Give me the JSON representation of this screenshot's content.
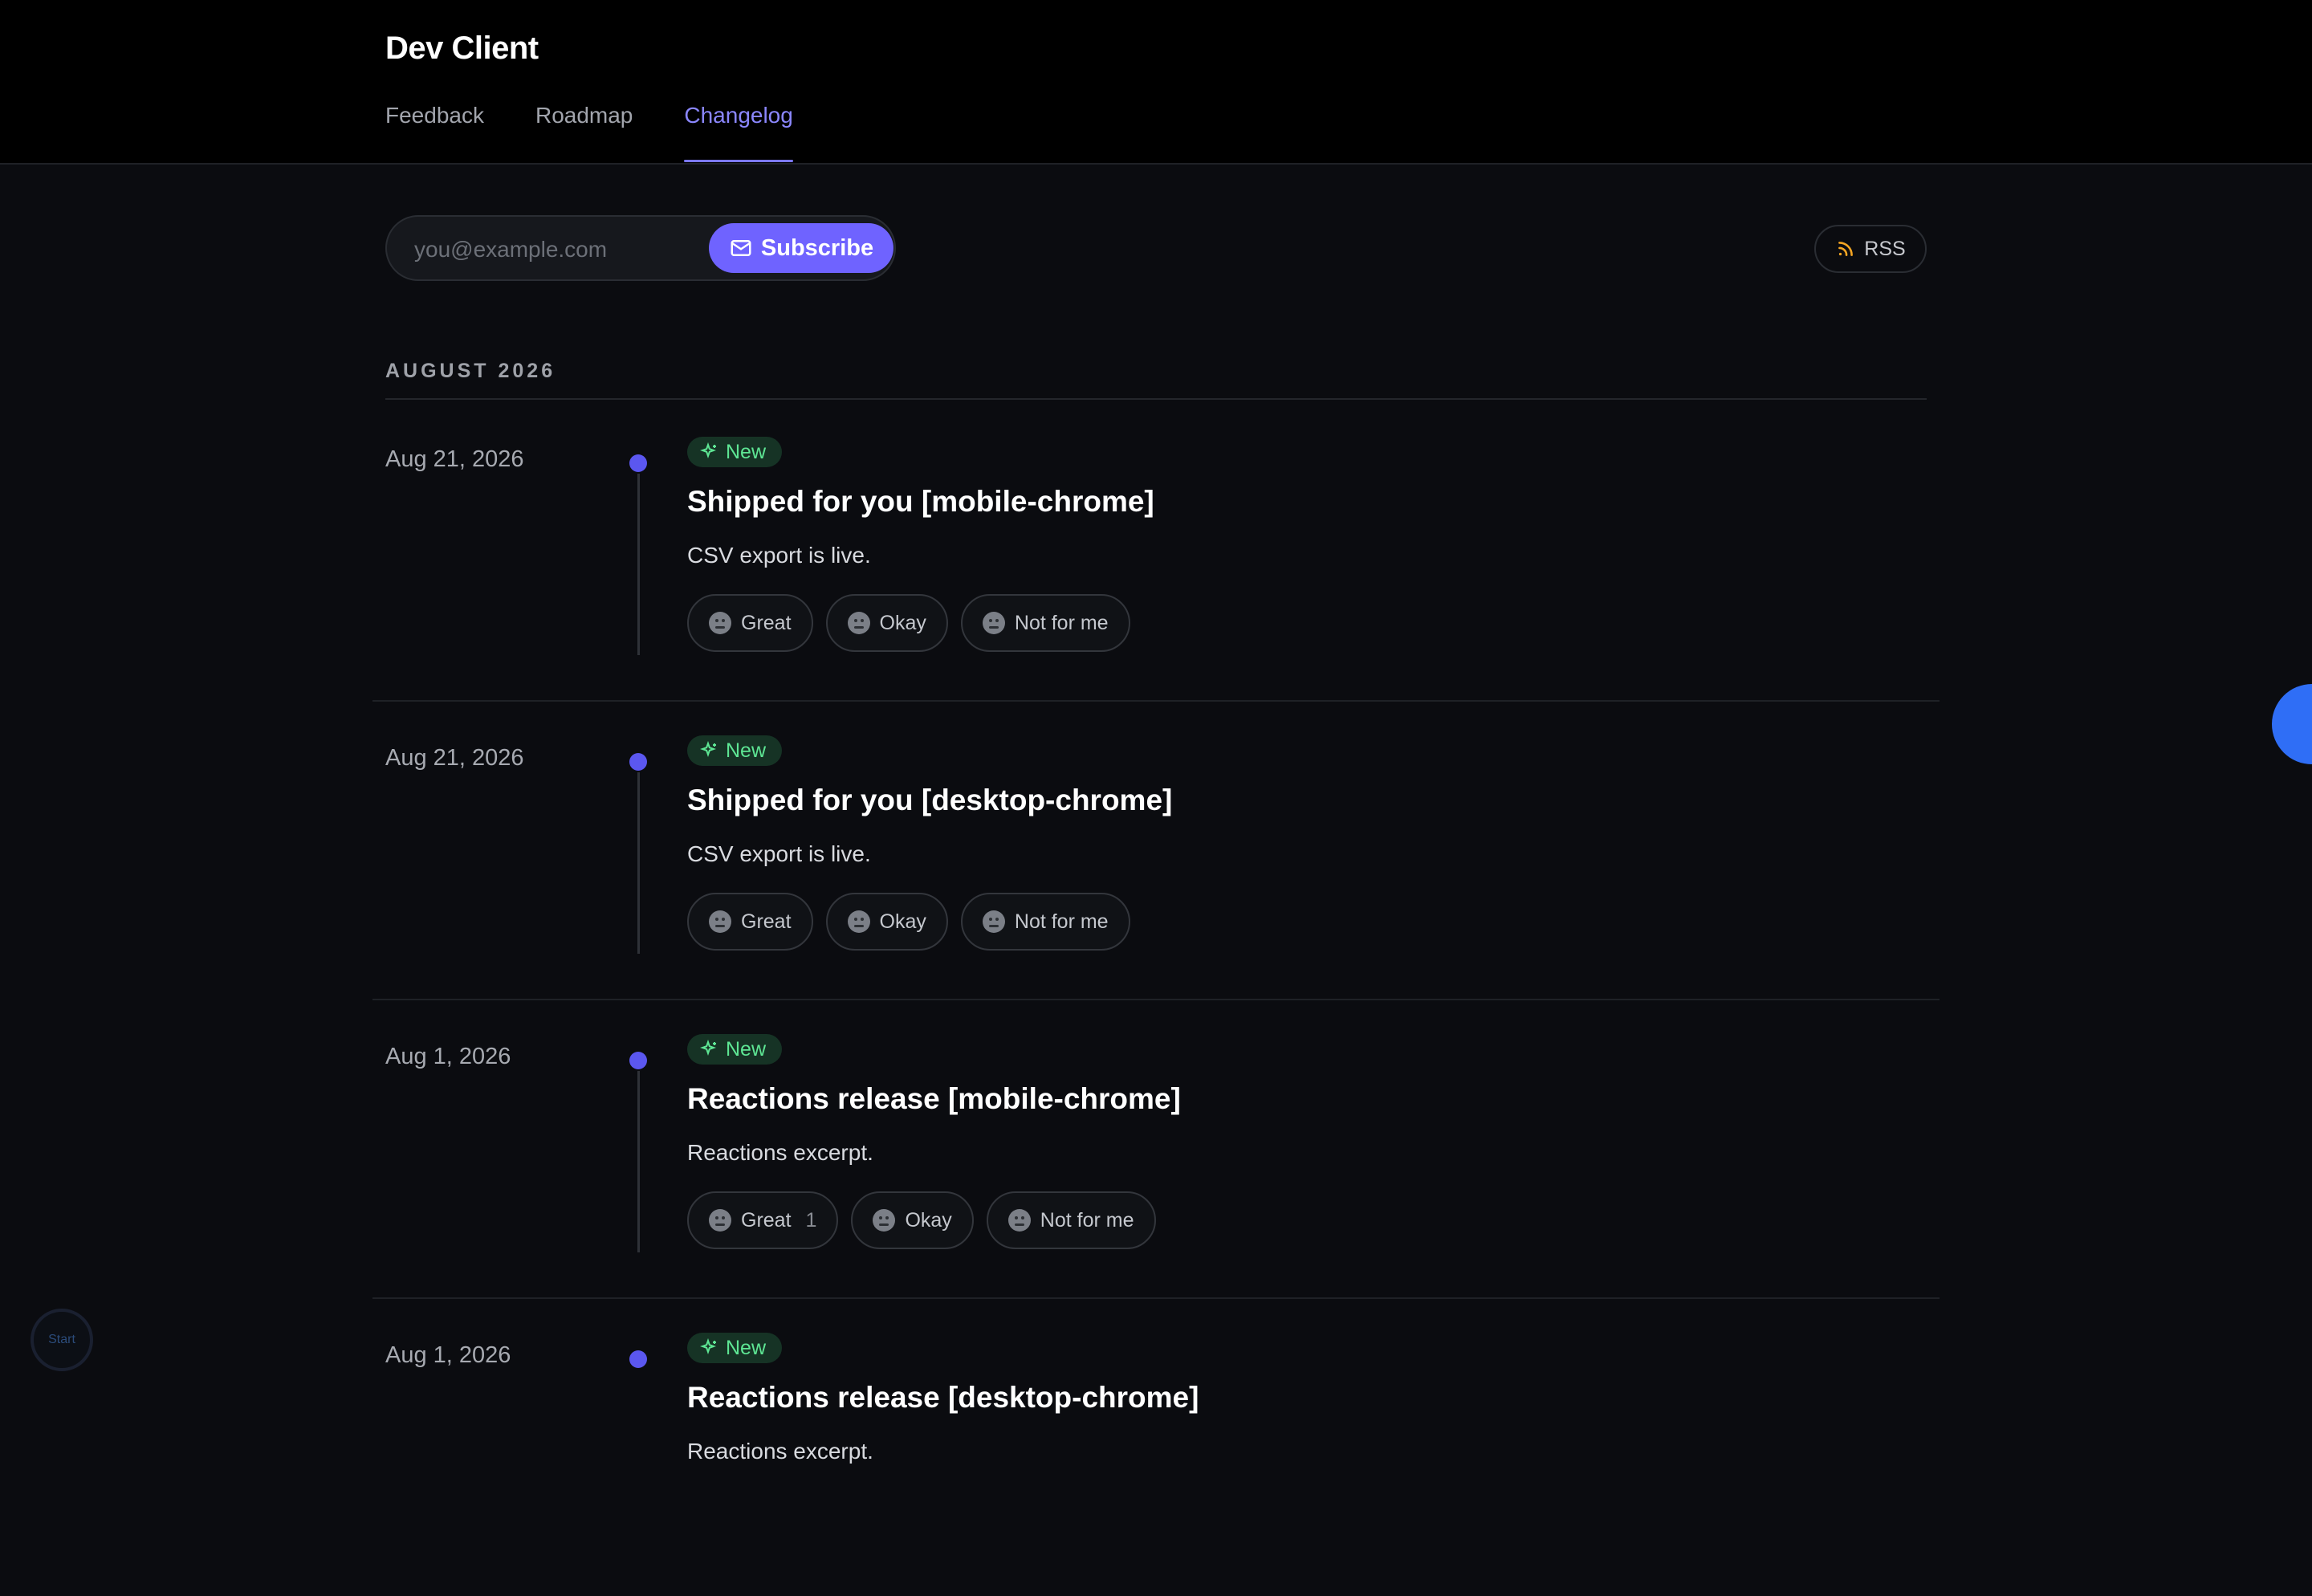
{
  "app": {
    "title": "Dev Client"
  },
  "nav": {
    "tabs": [
      {
        "label": "Feedback"
      },
      {
        "label": "Roadmap"
      },
      {
        "label": "Changelog"
      }
    ]
  },
  "subscribe": {
    "placeholder": "you@example.com",
    "button_label": "Subscribe",
    "icon": "mail-icon"
  },
  "rss": {
    "label": "RSS",
    "icon": "rss-icon"
  },
  "month": "AUGUST 2026",
  "entries": [
    {
      "date": "Aug 21, 2026",
      "badge": "New",
      "title": "Shipped for you [mobile-chrome]",
      "excerpt": "CSV export is live.",
      "reactions": [
        {
          "label": "Great",
          "count": ""
        },
        {
          "label": "Okay",
          "count": ""
        },
        {
          "label": "Not for me",
          "count": ""
        }
      ]
    },
    {
      "date": "Aug 21, 2026",
      "badge": "New",
      "title": "Shipped for you [desktop-chrome]",
      "excerpt": "CSV export is live.",
      "reactions": [
        {
          "label": "Great",
          "count": ""
        },
        {
          "label": "Okay",
          "count": ""
        },
        {
          "label": "Not for me",
          "count": ""
        }
      ]
    },
    {
      "date": "Aug 1, 2026",
      "badge": "New",
      "title": "Reactions release [mobile-chrome]",
      "excerpt": "Reactions excerpt.",
      "reactions": [
        {
          "label": "Great",
          "count": "1"
        },
        {
          "label": "Okay",
          "count": ""
        },
        {
          "label": "Not for me",
          "count": ""
        }
      ]
    },
    {
      "date": "Aug 1, 2026",
      "badge": "New",
      "title": "Reactions release [desktop-chrome]",
      "excerpt": "Reactions excerpt.",
      "reactions": []
    }
  ],
  "start_widget": {
    "label": "Start"
  },
  "colors": {
    "accent": "#6f63ff",
    "badge_bg": "#163325",
    "badge_text": "#5ee694",
    "timeline_dot": "#5b57f0"
  }
}
